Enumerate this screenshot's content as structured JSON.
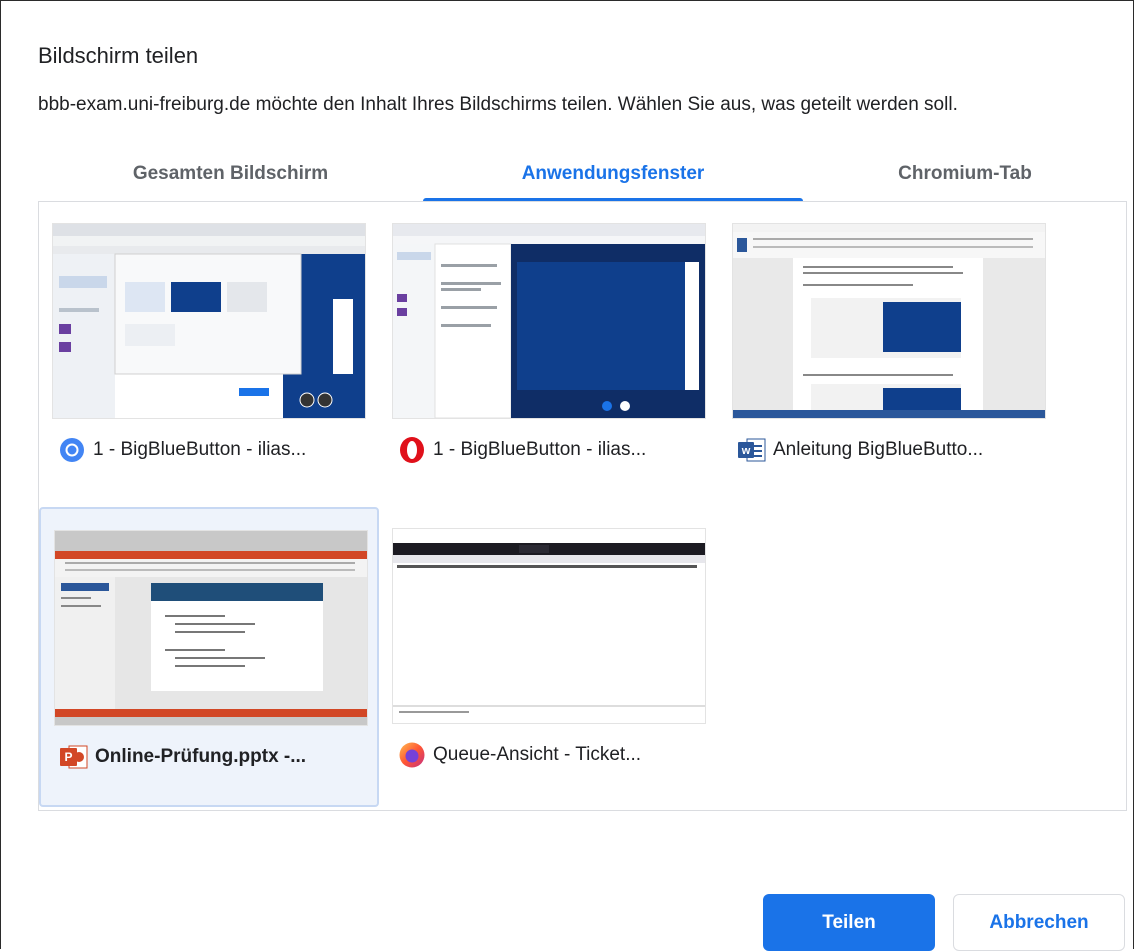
{
  "dialog": {
    "title": "Bildschirm teilen",
    "description": "bbb-exam.uni-freiburg.de möchte den Inhalt Ihres Bildschirms teilen. Wählen Sie aus, was geteilt werden soll."
  },
  "tabs": [
    {
      "label": "Gesamten Bildschirm",
      "active": false
    },
    {
      "label": "Anwendungsfenster",
      "active": true
    },
    {
      "label": "Chromium-Tab",
      "active": false
    }
  ],
  "windows": [
    {
      "label": "1 - BigBlueButton - ilias...",
      "icon": "chrome-icon",
      "selected": false
    },
    {
      "label": "1 - BigBlueButton - ilias...",
      "icon": "opera-icon",
      "selected": false
    },
    {
      "label": "Anleitung BigBlueButto...",
      "icon": "word-icon",
      "selected": false
    },
    {
      "label": "Online-Prüfung.pptx -...",
      "icon": "powerpoint-icon",
      "selected": true
    },
    {
      "label": "Queue-Ansicht - Ticket...",
      "icon": "firefox-icon",
      "selected": false
    }
  ],
  "buttons": {
    "share": "Teilen",
    "cancel": "Abbrechen"
  },
  "colors": {
    "accent": "#1a73e8",
    "bbb_blue": "#0f3f8c",
    "powerpoint_orange": "#d24726"
  }
}
